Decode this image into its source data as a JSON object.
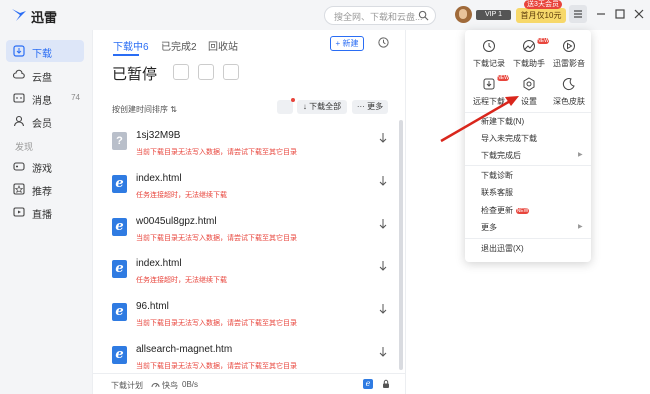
{
  "app": {
    "title": "迅雷"
  },
  "search": {
    "placeholder": "搜全网、下载和云盘..."
  },
  "header": {
    "vip_badge": "VIP 1",
    "promo_tag": "送3天会员",
    "promo_btn": "首月仅10元"
  },
  "sidebar": {
    "items": [
      {
        "label": "下载",
        "icon": "download-icon",
        "active": true
      },
      {
        "label": "云盘",
        "icon": "cloud-icon"
      },
      {
        "label": "消息",
        "icon": "message-icon",
        "count": "74"
      },
      {
        "label": "会员",
        "icon": "vip-icon"
      }
    ],
    "section_label": "发现",
    "discover": [
      {
        "label": "游戏",
        "icon": "game-icon"
      },
      {
        "label": "推荐",
        "icon": "recommend-icon"
      },
      {
        "label": "直播",
        "icon": "live-icon"
      }
    ]
  },
  "main": {
    "tabs": [
      {
        "label": "下载中6",
        "active": true
      },
      {
        "label": "已完成2"
      },
      {
        "label": "回收站"
      }
    ],
    "new_label": "+ 新建",
    "status_title": "已暂停",
    "sort_label": "按创建时间排序 ⇅",
    "download_all": "↓ 下载全部",
    "more": "··· 更多",
    "items": [
      {
        "name": "1sj32M9B",
        "icon": "unknown",
        "error": "当前下载目录无法写入数据，请尝试下载至其它目录"
      },
      {
        "name": "index.html",
        "icon": "ie",
        "error": "任务连接超时，无法继续下载"
      },
      {
        "name": "w0045ul8gpz.html",
        "icon": "ie",
        "error": "当前下载目录无法写入数据，请尝试下载至其它目录"
      },
      {
        "name": "index.html",
        "icon": "ie",
        "error": "任务连接超时，无法继续下载"
      },
      {
        "name": "96.html",
        "icon": "ie",
        "error": "当前下载目录无法写入数据，请尝试下载至其它目录"
      },
      {
        "name": "allsearch-magnet.htm",
        "icon": "ie",
        "error": "当前下载目录无法写入数据，请尝试下载至其它目录"
      }
    ],
    "bottom": {
      "plan": "下载计划",
      "mode": "快鸟",
      "speed": "0B/s"
    }
  },
  "menu": {
    "grid": [
      {
        "label": "下载记录",
        "icon": "history-icon"
      },
      {
        "label": "下载助手",
        "icon": "assistant-icon",
        "new": true
      },
      {
        "label": "迅雷影音",
        "icon": "player-icon"
      },
      {
        "label": "远程下载",
        "icon": "remote-download-icon",
        "new": true
      },
      {
        "label": "设置",
        "icon": "settings-icon"
      },
      {
        "label": "深色皮肤",
        "icon": "moon-icon"
      }
    ],
    "new_tag": "NEW",
    "items": [
      {
        "label": "新建下载(N)"
      },
      {
        "label": "导入未完成下载"
      },
      {
        "label": "下载完成后",
        "submenu": true
      },
      {
        "label": "下载诊断"
      },
      {
        "label": "联系客服"
      },
      {
        "label": "检查更新",
        "new": true
      },
      {
        "label": "更多",
        "submenu": true
      },
      {
        "label": "退出迅雷(X)"
      }
    ]
  }
}
